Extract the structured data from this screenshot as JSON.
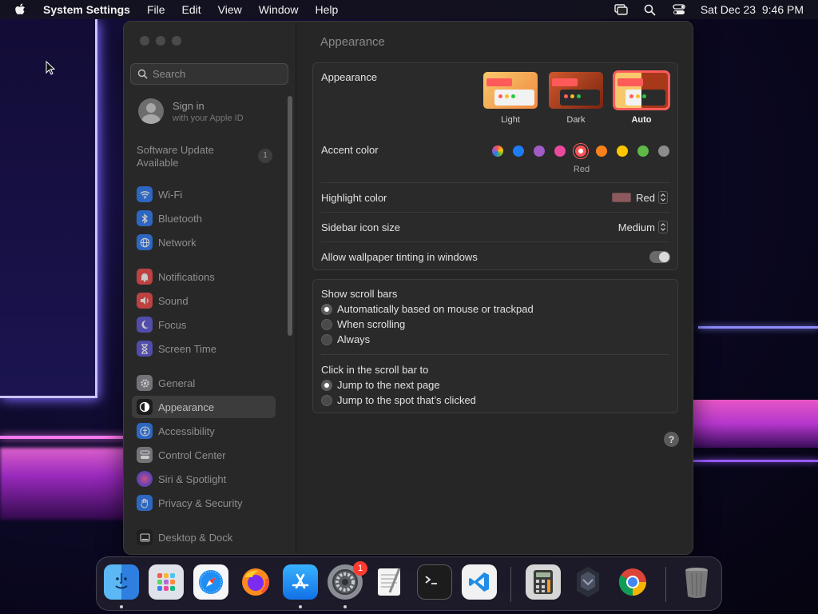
{
  "menubar": {
    "app_name": "System Settings",
    "items": [
      "File",
      "Edit",
      "View",
      "Window",
      "Help"
    ],
    "datetime": "Sat Dec 23  9:46 PM"
  },
  "sidebar": {
    "search_placeholder": "Search",
    "signin": {
      "title": "Sign in",
      "subtitle": "with your Apple ID"
    },
    "update": {
      "label": "Software Update Available",
      "badge": "1"
    },
    "items": [
      {
        "label": "Wi-Fi",
        "icon": "wifi-icon",
        "color": "#2f7cf6"
      },
      {
        "label": "Bluetooth",
        "icon": "bluetooth-icon",
        "color": "#2f7cf6"
      },
      {
        "label": "Network",
        "icon": "globe-icon",
        "color": "#2f7cf6"
      },
      {
        "label": "Notifications",
        "icon": "bell-icon",
        "color": "#f04a4a"
      },
      {
        "label": "Sound",
        "icon": "speaker-icon",
        "color": "#f04a4a"
      },
      {
        "label": "Focus",
        "icon": "moon-icon",
        "color": "#6158d6"
      },
      {
        "label": "Screen Time",
        "icon": "hourglass-icon",
        "color": "#6158d6"
      },
      {
        "label": "General",
        "icon": "gear-icon",
        "color": "#8e8e93"
      },
      {
        "label": "Appearance",
        "icon": "appearance-icon",
        "color": "#1c1c1e"
      },
      {
        "label": "Accessibility",
        "icon": "accessibility-icon",
        "color": "#2f7cf6"
      },
      {
        "label": "Control Center",
        "icon": "control-center-icon",
        "color": "#8e8e93"
      },
      {
        "label": "Siri & Spotlight",
        "icon": "siri-icon",
        "color": "#b04ad8"
      },
      {
        "label": "Privacy & Security",
        "icon": "hand-icon",
        "color": "#2f7cf6"
      },
      {
        "label": "Desktop & Dock",
        "icon": "dock-icon",
        "color": "#1c1c1e"
      }
    ]
  },
  "main": {
    "title": "Appearance",
    "appearance": {
      "label": "Appearance",
      "options": [
        "Light",
        "Dark",
        "Auto"
      ],
      "selected": "Auto"
    },
    "accent": {
      "label": "Accent color",
      "selected_name": "Red",
      "colors": [
        "multicolor",
        "#1e7cf2",
        "#a05bc4",
        "#e94a9b",
        "#ff5257",
        "#f7821b",
        "#ffc600",
        "#5fb848",
        "#8c8c8c"
      ]
    },
    "highlight": {
      "label": "Highlight color",
      "value": "Red"
    },
    "icon_size": {
      "label": "Sidebar icon size",
      "value": "Medium"
    },
    "tinting": {
      "label": "Allow wallpaper tinting in windows",
      "on": true
    },
    "scroll_bars": {
      "label": "Show scroll bars",
      "options": [
        "Automatically based on mouse or trackpad",
        "When scrolling",
        "Always"
      ],
      "selected": 0
    },
    "click_scroll": {
      "label": "Click in the scroll bar to",
      "options": [
        "Jump to the next page",
        "Jump to the spot that’s clicked"
      ],
      "selected": 0
    },
    "help": "?"
  },
  "dock": {
    "apps": [
      "finder-icon",
      "launchpad-icon",
      "safari-icon",
      "firefox-icon",
      "app-store-icon",
      "system-settings-icon",
      "textedit-icon",
      "terminal-icon",
      "vscode-icon",
      "calculator-icon",
      "game-icon",
      "chrome-icon",
      "trash-icon"
    ],
    "settings_badge": "1"
  }
}
